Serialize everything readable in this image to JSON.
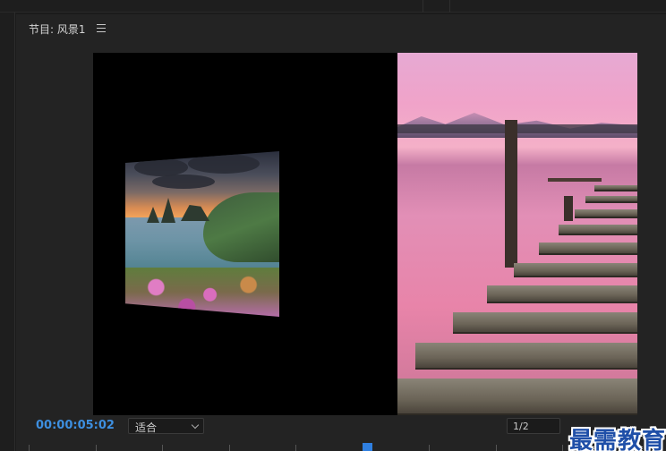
{
  "panel": {
    "title": "节目: 风景1",
    "menu_icon": "hamburger-menu-icon"
  },
  "controls": {
    "timecode": "00:00:05:02",
    "fit_value": "适合",
    "resolution_value": "1/2"
  },
  "watermark": "最需教育",
  "colors": {
    "timecode": "#3d8fe0",
    "playhead": "#2f7fe0",
    "panel_bg": "#232323",
    "watermark": "#1f4fa8"
  }
}
